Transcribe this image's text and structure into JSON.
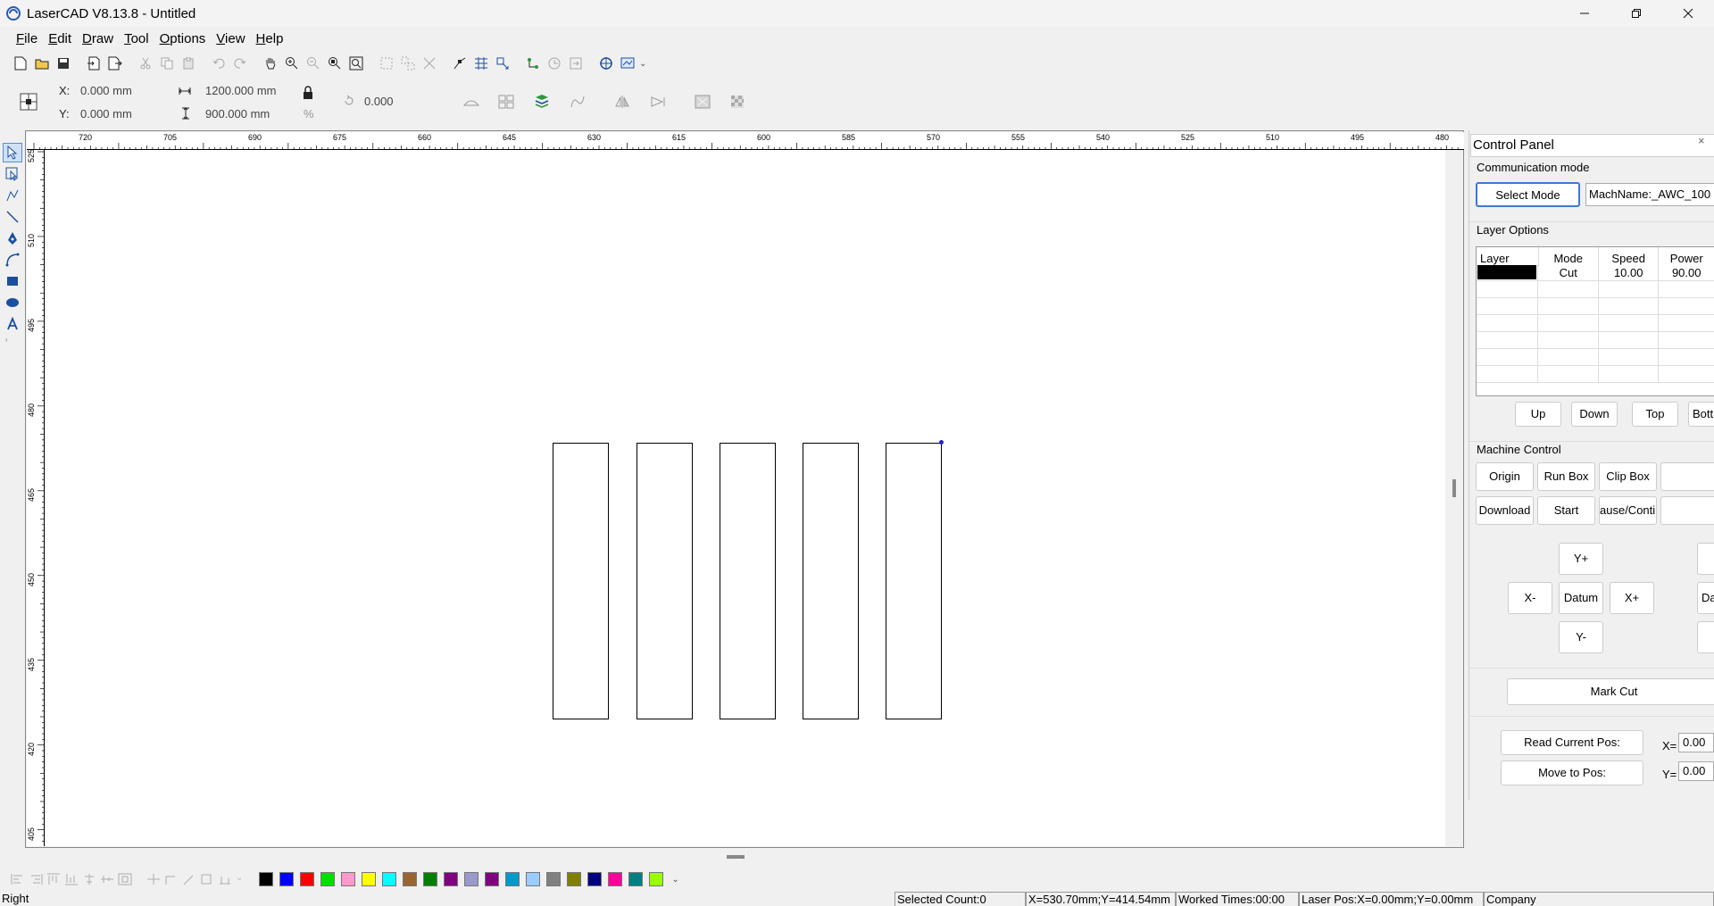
{
  "window": {
    "title": "LaserCAD V8.13.8 - Untitled"
  },
  "menu": [
    {
      "label": "File",
      "key": "F",
      "rest": "ile"
    },
    {
      "label": "Edit",
      "key": "E",
      "rest": "dit"
    },
    {
      "label": "Draw",
      "key": "D",
      "rest": "raw"
    },
    {
      "label": "Tool",
      "key": "T",
      "rest": "ool"
    },
    {
      "label": "Options",
      "key": "O",
      "rest": "ptions"
    },
    {
      "label": "View",
      "key": "V",
      "rest": "iew"
    },
    {
      "label": "Help",
      "key": "H",
      "rest": "elp"
    }
  ],
  "properties": {
    "x_label": "X:",
    "x_value": "0.000 mm",
    "y_label": "Y:",
    "y_value": "0.000 mm",
    "width_value": "1200.000 mm",
    "height_value": "900.000 mm",
    "rotation_value": "0.000",
    "percent_label": "%"
  },
  "ruler": {
    "horizontal_ticks": [
      "720",
      "705",
      "690",
      "675",
      "660",
      "645",
      "630",
      "615",
      "600",
      "585",
      "570",
      "555",
      "540",
      "525",
      "510",
      "495",
      "480"
    ],
    "vertical_ticks": [
      "525",
      "510",
      "495",
      "480",
      "465",
      "450",
      "435",
      "420",
      "405"
    ]
  },
  "palette_colors": [
    "#000000",
    "#0000ff",
    "#ff0000",
    "#00e000",
    "#ff99cc",
    "#ffff00",
    "#00ffff",
    "#996633",
    "#008000",
    "#800080",
    "#9999cc",
    "#800080",
    "#0099cc",
    "#99ccff",
    "#808080",
    "#808000",
    "#000080",
    "#ff0099",
    "#008080",
    "#99ff00"
  ],
  "status": {
    "left": "Right",
    "selected": "Selected Count:0",
    "cursor_pos": "X=530.70mm;Y=414.54mm",
    "worked": "Worked Times:00:00",
    "laser_pos": "Laser Pos:X=0.00mm;Y=0.00mm",
    "company": "Company"
  },
  "control_panel": {
    "title": "Control Panel",
    "close": "×",
    "communication": {
      "heading": "Communication mode",
      "select_mode": "Select Mode",
      "machine_name": "MachName:_AWC_100"
    },
    "layer_options": {
      "heading": "Layer Options",
      "columns": [
        "Layer",
        "Mode",
        "Speed",
        "Power"
      ],
      "rows": [
        {
          "color": "#000000",
          "mode": "Cut",
          "speed": "10.00",
          "power": "90.00"
        }
      ],
      "buttons": [
        "Up",
        "Down",
        "Top",
        "Bott"
      ]
    },
    "machine_control": {
      "heading": "Machine Control",
      "row1": [
        "Origin",
        "Run Box",
        "Clip Box"
      ],
      "row2": [
        "Download",
        "Start",
        "ause/Continu"
      ],
      "jog": {
        "y_plus": "Y+",
        "x_minus": "X-",
        "datum": "Datum",
        "x_plus": "X+",
        "y_minus": "Y-",
        "partial_right": "Da"
      }
    },
    "mark_cut": "Mark Cut",
    "read_pos": "Read Current Pos:",
    "move_to_pos": "Move to Pos:",
    "x_label": "X=",
    "x_value": "0.00",
    "y_label": "Y=",
    "y_value": "0.00"
  }
}
